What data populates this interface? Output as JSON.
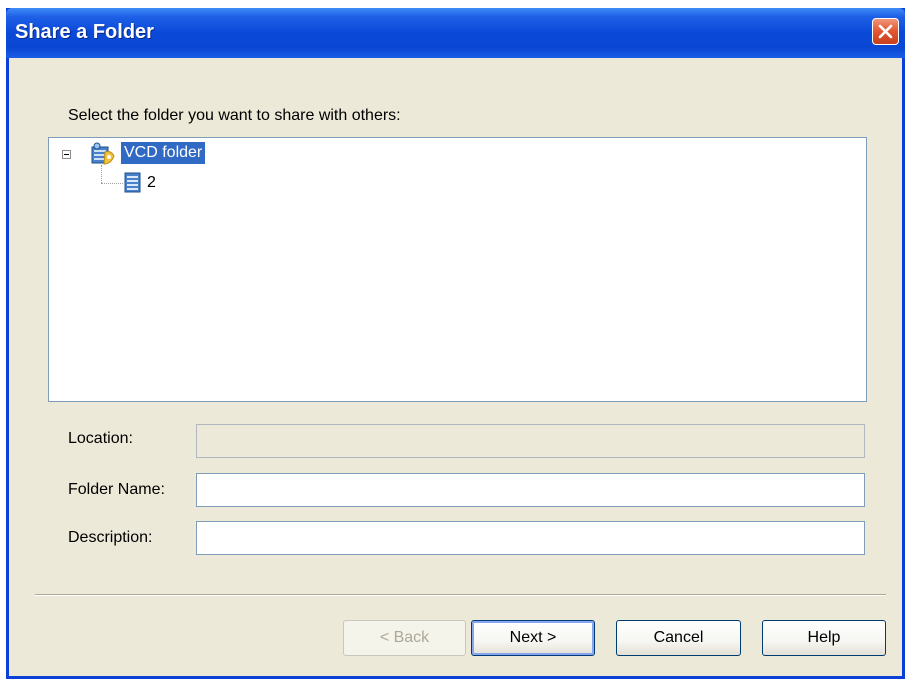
{
  "window": {
    "title": "Share a Folder",
    "close_icon": "close-x-icon"
  },
  "prompt": "Select the folder you want to share with others:",
  "tree": {
    "root": {
      "label": "VCD folder",
      "icon": "vcd-folder-icon",
      "expanded": true,
      "selected": true
    },
    "children": [
      {
        "label": "2",
        "icon": "document-icon"
      }
    ]
  },
  "fields": {
    "location": {
      "label": "Location:",
      "value": "",
      "disabled": true
    },
    "folder_name": {
      "label": "Folder Name:",
      "value": ""
    },
    "description": {
      "label": "Description:",
      "value": ""
    }
  },
  "buttons": {
    "back": "< Back",
    "next": "Next >",
    "cancel": "Cancel",
    "help": "Help"
  },
  "colors": {
    "titlebar": "#0a47d3",
    "selection": "#316ac5",
    "dialog_bg": "#ece9d8"
  }
}
